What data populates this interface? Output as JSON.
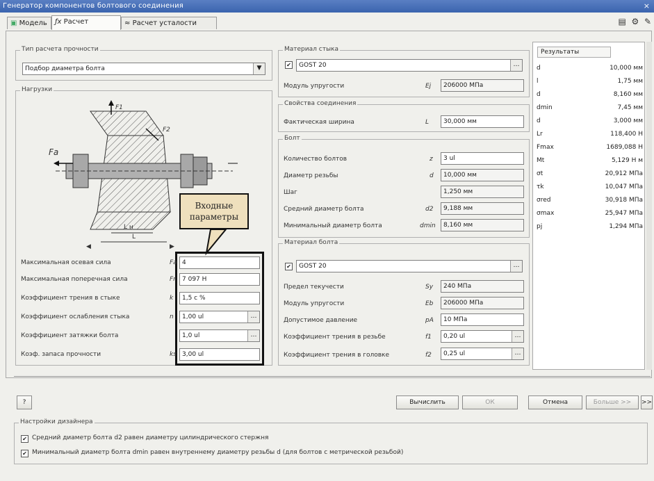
{
  "window": {
    "title": "Генератор компонентов болтового соединения",
    "close": "×"
  },
  "tabs": [
    {
      "label": "Модель",
      "icon": "model-icon"
    },
    {
      "label": "Расчет",
      "icon": "calc-icon"
    },
    {
      "label": "Расчет усталости",
      "icon": "fatigue-icon"
    }
  ],
  "toolbar_icons": [
    "export-icon",
    "settings-icon",
    "edit-icon"
  ],
  "calc_type": {
    "title": "Тип расчета прочности",
    "value": "Подбор диаметра болта"
  },
  "sketch": {
    "title": "Нагрузки",
    "labels": {
      "f1": "F1",
      "f2": "F2",
      "fa": "Fa",
      "lh": "L н",
      "l": "L"
    }
  },
  "callout": {
    "line1": "Входные",
    "line2": "параметры"
  },
  "left_inputs": [
    {
      "label": "Максимальная осевая сила",
      "sym": "Fa",
      "value": "4"
    },
    {
      "label": "Максимальная поперечная сила",
      "sym": "Fr",
      "value": "7 097 Н"
    },
    {
      "label": "Коэффициент трения в стыке",
      "sym": "k",
      "value": "1,5 с %"
    },
    {
      "label": "Коэффициент ослабления стыка",
      "sym": "n",
      "value": "1,00 ul",
      "dots": true
    },
    {
      "label": "Коэффициент затяжки болта",
      "sym": "",
      "value": "1,0 ul",
      "dots": true
    },
    {
      "label": "Коэф. запаса прочности",
      "sym": "ks",
      "value": "3,00 ul"
    }
  ],
  "joint_material": {
    "title": "Материал стыка",
    "standard": "GOST 20",
    "modulus_label": "Модуль упругости",
    "modulus_sym": "Ej",
    "modulus_value": "206000 МПа"
  },
  "joint_props": {
    "title": "Свойства соединения",
    "width_label": "Фактическая ширина",
    "width_sym": "L",
    "width_value": "30,000 мм"
  },
  "bolt": {
    "title": "Болт",
    "rows": [
      {
        "label": "Количество болтов",
        "sym": "z",
        "value": "3 ul",
        "ro": false
      },
      {
        "label": "Диаметр резьбы",
        "sym": "d",
        "value": "10,000 мм",
        "ro": true
      },
      {
        "label": "Шаг",
        "sym": "",
        "value": "1,250 мм",
        "ro": true
      },
      {
        "label": "Средний диаметр болта",
        "sym": "d2",
        "value": "9,188 мм",
        "ro": true
      },
      {
        "label": "Минимальный диаметр болта",
        "sym": "dmin",
        "value": "8,160 мм",
        "ro": true
      }
    ]
  },
  "bolt_material": {
    "title": "Материал болта",
    "standard": "GOST 20",
    "rows": [
      {
        "label": "Предел текучести",
        "sym": "Sy",
        "value": "240 МПа",
        "ro": true,
        "dots": false
      },
      {
        "label": "Модуль упругости",
        "sym": "Eb",
        "value": "206000 МПа",
        "ro": true,
        "dots": false
      },
      {
        "label": "Допустимое давление",
        "sym": "pA",
        "value": "10 МПа",
        "ro": false,
        "dots": false
      },
      {
        "label": "Коэффициент трения в резьбе",
        "sym": "f1",
        "value": "0,20 ul",
        "ro": false,
        "dots": true
      },
      {
        "label": "Коэффициент трения в головке",
        "sym": "f2",
        "value": "0,25 ul",
        "ro": false,
        "dots": true
      }
    ]
  },
  "results": {
    "title": "Результаты",
    "rows": [
      {
        "label": "d",
        "value": "10,000 мм"
      },
      {
        "label": "l",
        "value": "1,75 мм"
      },
      {
        "label": "d",
        "value": "8,160 мм"
      },
      {
        "label": "dmin",
        "value": "7,45 мм"
      },
      {
        "label": "d",
        "value": "3,000 мм"
      },
      {
        "label": "Lr",
        "value": "118,400 Н"
      },
      {
        "label": "Fmax",
        "value": "1689,088 Н"
      },
      {
        "label": "Mt",
        "value": "5,129 Н м"
      },
      {
        "label": "σt",
        "value": "20,912 МПа"
      },
      {
        "label": "τk",
        "value": "10,047 МПа"
      },
      {
        "label": "σred",
        "value": "30,918 МПа"
      },
      {
        "label": "σmax",
        "value": "25,947 МПа"
      },
      {
        "label": "pj",
        "value": "1,294 МПа"
      }
    ]
  },
  "buttons": {
    "help": "?",
    "calculate": "Вычислить",
    "ok": "ОК",
    "cancel": "Отмена",
    "more": "Больше >>",
    "expand": ">>"
  },
  "more_options": {
    "title": "Настройки дизайнера",
    "opt1": "Средний диаметр болта d2 равен диаметру цилиндрического стержня",
    "opt2": "Минимальный диаметр болта dmin равен внутреннему диаметру резьбы d (для болтов с метрической резьбой)"
  }
}
